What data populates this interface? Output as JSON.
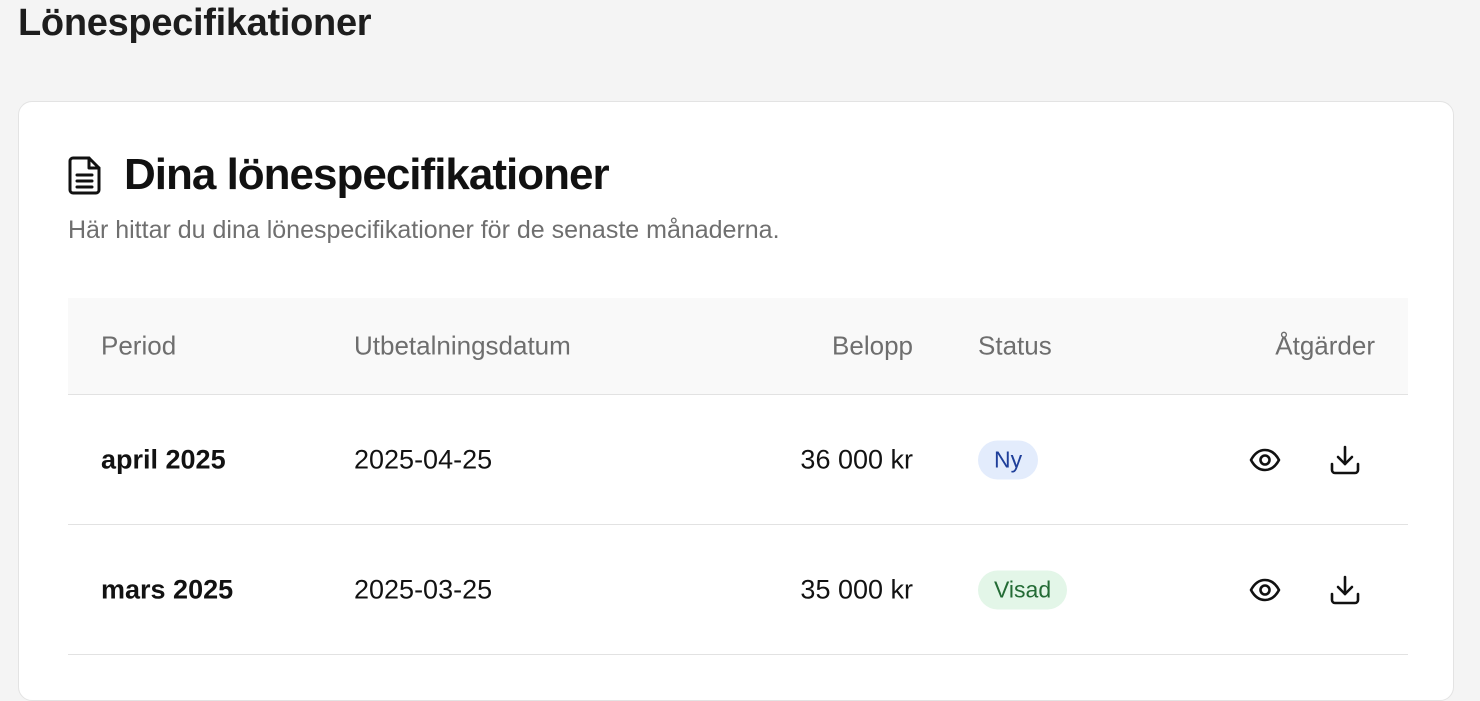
{
  "page": {
    "title": "Lönespecifikationer"
  },
  "card": {
    "icon": "document-icon",
    "title": "Dina lönespecifikationer",
    "subtitle": "Här hittar du dina lönespecifikationer för de senaste månaderna."
  },
  "table": {
    "headers": {
      "period": "Period",
      "date": "Utbetalningsdatum",
      "amount": "Belopp",
      "status": "Status",
      "actions": "Åtgärder"
    },
    "rows": [
      {
        "period": "april 2025",
        "date": "2025-04-25",
        "amount": "36 000 kr",
        "status": "Ny",
        "status_color": "#e3ecfc",
        "actions": [
          "eye-icon",
          "download-icon"
        ]
      },
      {
        "period": "mars 2025",
        "date": "2025-03-25",
        "amount": "35 000 kr",
        "status": "Visad",
        "status_color": "#e3f6e8",
        "actions": [
          "eye-icon",
          "download-icon"
        ]
      }
    ]
  }
}
